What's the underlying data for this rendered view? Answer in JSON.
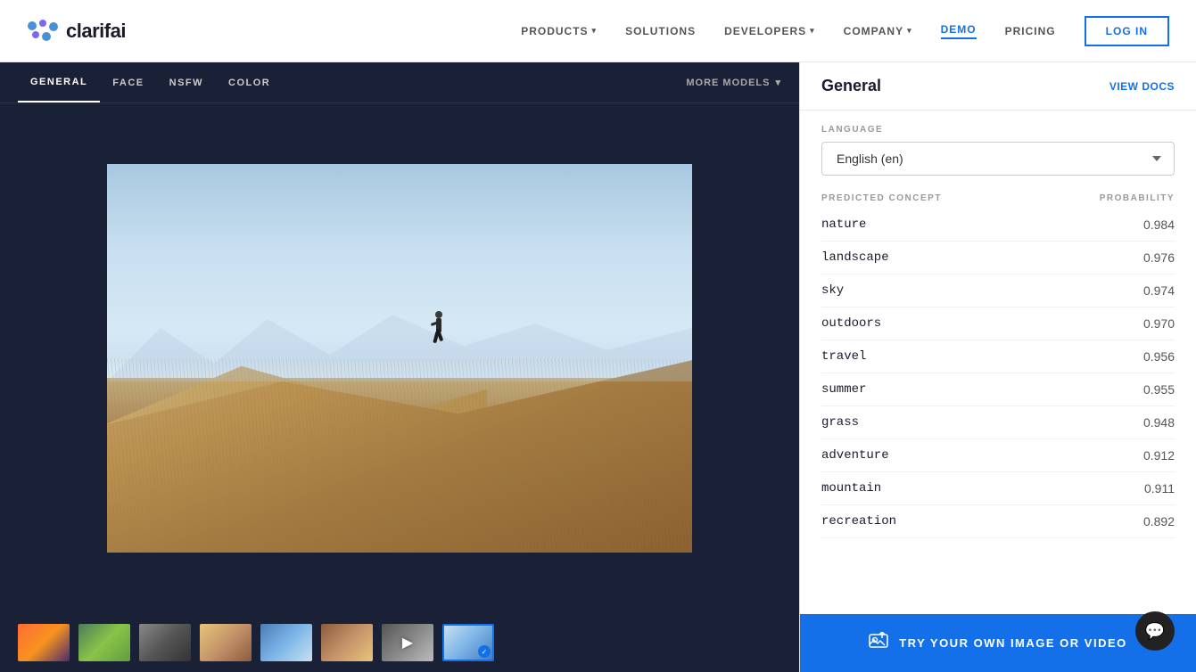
{
  "header": {
    "logo_text": "clarifai",
    "nav_items": [
      {
        "label": "PRODUCTS",
        "has_dropdown": true
      },
      {
        "label": "SOLUTIONS",
        "has_dropdown": false
      },
      {
        "label": "DEVELOPERS",
        "has_dropdown": true
      },
      {
        "label": "COMPANY",
        "has_dropdown": true
      },
      {
        "label": "DEMO",
        "active": true
      },
      {
        "label": "PRICING",
        "has_dropdown": false
      }
    ],
    "login_label": "LOG IN"
  },
  "model_tabs": {
    "tabs": [
      {
        "label": "GENERAL",
        "active": true
      },
      {
        "label": "FACE",
        "active": false
      },
      {
        "label": "NSFW",
        "active": false
      },
      {
        "label": "COLOR",
        "active": false
      }
    ],
    "more_models_label": "MORE MODELS"
  },
  "right_panel": {
    "model_name": "General",
    "view_docs_label": "VIEW DOCS",
    "language_label": "LANGUAGE",
    "language_value": "English (en)",
    "predicted_concept_label": "PREDICTED CONCEPT",
    "probability_label": "PROBABILITY",
    "predictions": [
      {
        "concept": "nature",
        "probability": "0.984"
      },
      {
        "concept": "landscape",
        "probability": "0.976"
      },
      {
        "concept": "sky",
        "probability": "0.974"
      },
      {
        "concept": "outdoors",
        "probability": "0.970"
      },
      {
        "concept": "travel",
        "probability": "0.956"
      },
      {
        "concept": "summer",
        "probability": "0.955"
      },
      {
        "concept": "grass",
        "probability": "0.948"
      },
      {
        "concept": "adventure",
        "probability": "0.912"
      },
      {
        "concept": "mountain",
        "probability": "0.911"
      },
      {
        "concept": "recreation",
        "probability": "0.892"
      }
    ],
    "cta_label": "TRY YOUR OWN IMAGE OR VIDEO"
  },
  "thumbnails": [
    {
      "id": 1,
      "selected": false
    },
    {
      "id": 2,
      "selected": false
    },
    {
      "id": 3,
      "selected": false
    },
    {
      "id": 4,
      "selected": false
    },
    {
      "id": 5,
      "selected": false
    },
    {
      "id": 6,
      "selected": false
    },
    {
      "id": 7,
      "selected": false,
      "is_video": true
    },
    {
      "id": 8,
      "selected": true
    }
  ]
}
